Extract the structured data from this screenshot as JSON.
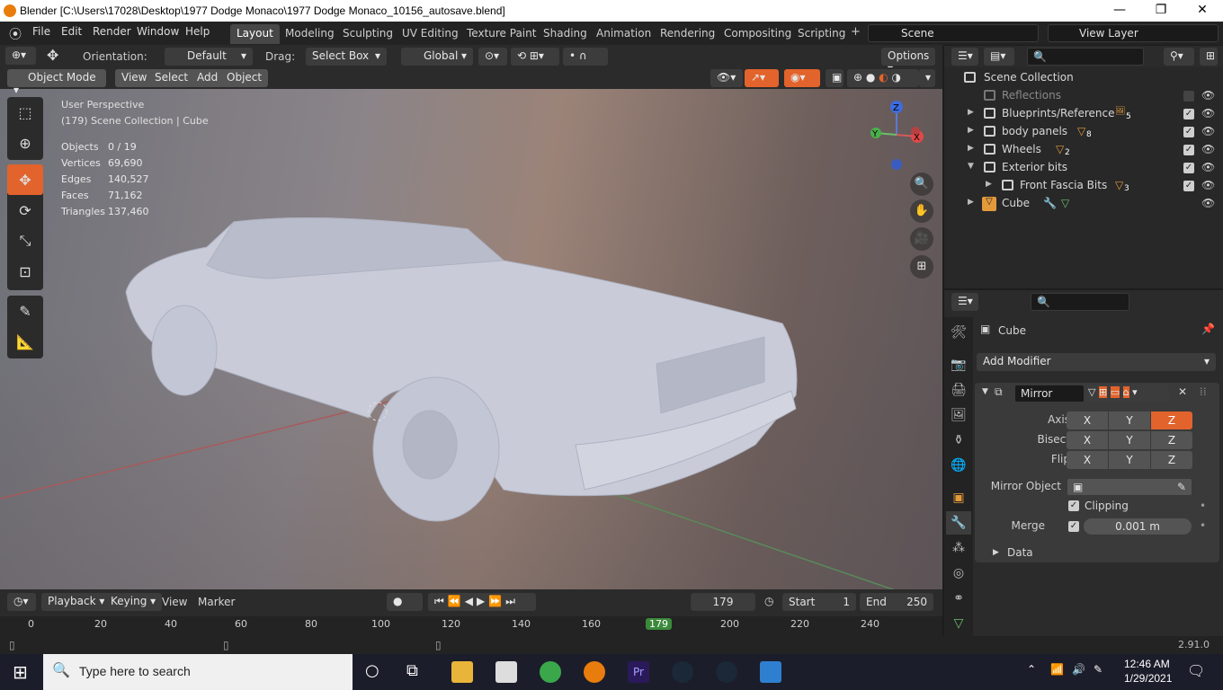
{
  "window": {
    "title": "Blender [C:\\Users\\17028\\Desktop\\1977 Dodge Monaco\\1977 Dodge Monaco_10156_autosave.blend]",
    "minimize": "—",
    "maximize": "❐",
    "close": "✕"
  },
  "menu": [
    "File",
    "Edit",
    "Render",
    "Window",
    "Help"
  ],
  "workspaces": [
    "Layout",
    "Modeling",
    "Sculpting",
    "UV Editing",
    "Texture Paint",
    "Shading",
    "Animation",
    "Rendering",
    "Compositing",
    "Scripting"
  ],
  "active_workspace": "Layout",
  "scene_name": "Scene",
  "view_layer": "View Layer",
  "toolheader": {
    "orientation_label": "Orientation:",
    "orientation_value": "Default",
    "drag_label": "Drag:",
    "drag_value": "Select Box",
    "transform_space": "Global",
    "options": "Options"
  },
  "viewport_header": {
    "mode": "Object Mode",
    "view": "View",
    "select": "Select",
    "add": "Add",
    "object": "Object"
  },
  "viewport": {
    "perspective": "User Perspective",
    "collection": "(179) Scene Collection | Cube",
    "stats": [
      {
        "k": "Objects",
        "v": "0 / 19"
      },
      {
        "k": "Vertices",
        "v": "69,690"
      },
      {
        "k": "Edges",
        "v": "140,527"
      },
      {
        "k": "Faces",
        "v": "71,162"
      },
      {
        "k": "Triangles",
        "v": "137,460"
      }
    ],
    "gizmo": {
      "x": "X",
      "y": "Y",
      "z": "Z"
    }
  },
  "outliner": {
    "root": "Scene Collection",
    "items": [
      {
        "label": "Reflections",
        "badge": ""
      },
      {
        "label": "Blueprints/Reference",
        "badge": "5"
      },
      {
        "label": "body panels",
        "badge": "8"
      },
      {
        "label": "Wheels",
        "badge": "2"
      },
      {
        "label": "Exterior bits",
        "badge": ""
      },
      {
        "label": "Front Fascia Bits",
        "badge": "3"
      },
      {
        "label": "Cube",
        "badge": ""
      }
    ]
  },
  "properties": {
    "object_name": "Cube",
    "add_modifier": "Add Modifier",
    "modifier_name": "Mirror",
    "axis_label": "Axis",
    "bisect_label": "Bisect",
    "flip_label": "Flip",
    "axes": [
      "X",
      "Y",
      "Z"
    ],
    "axis_enabled": "Z",
    "mirror_object_label": "Mirror Object",
    "clipping_label": "Clipping",
    "clipping_checked": true,
    "merge_label": "Merge",
    "merge_value": "0.001 m",
    "data_label": "Data"
  },
  "timeline": {
    "playback": "Playback",
    "keying": "Keying",
    "view": "View",
    "marker": "Marker",
    "current_frame": "179",
    "start_label": "Start",
    "start": "1",
    "end_label": "End",
    "end": "250",
    "ticks": [
      "0",
      "20",
      "40",
      "60",
      "80",
      "100",
      "120",
      "140",
      "160",
      "179",
      "200",
      "220",
      "240"
    ]
  },
  "status": {
    "version": "2.91.0"
  },
  "taskbar": {
    "search_placeholder": "Type here to search",
    "time": "12:46 AM",
    "date": "1/29/2021"
  }
}
